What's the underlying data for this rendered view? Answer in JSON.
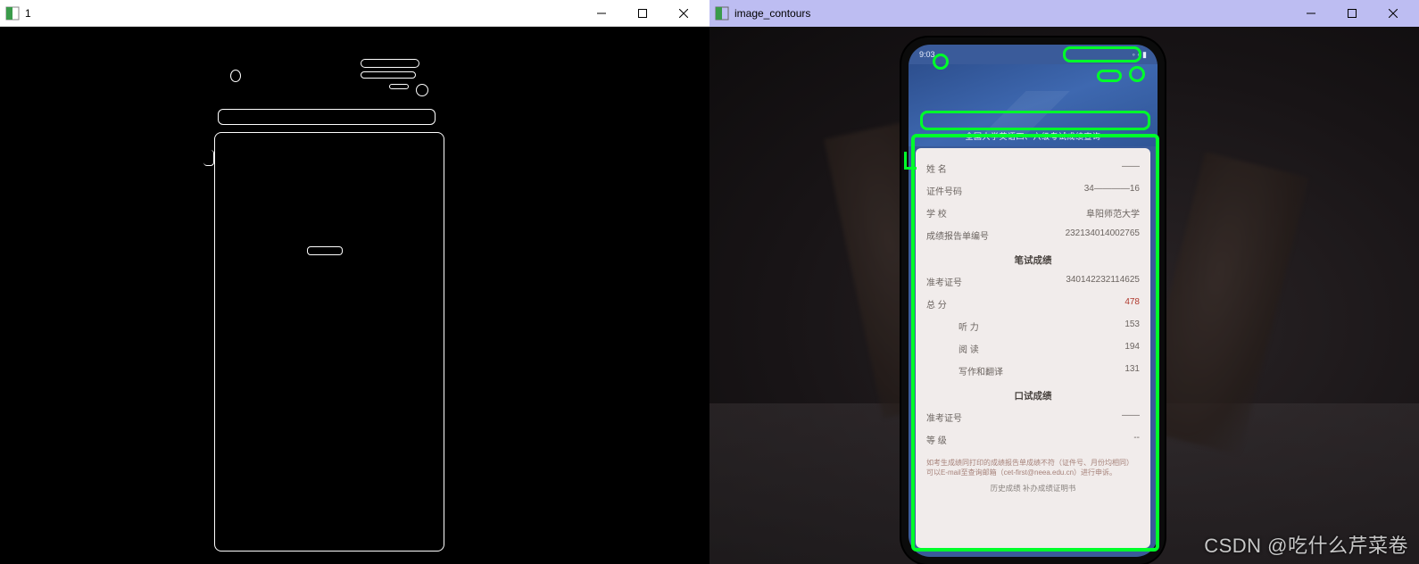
{
  "left_window": {
    "title": "1"
  },
  "right_window": {
    "title": "image_contours"
  },
  "phone": {
    "status_time": "9:03",
    "banner": "全国大学英语四、六级考试成绩查询",
    "fields": {
      "name_label": "姓 名",
      "name_value": "——",
      "id_label": "证件号码",
      "id_value": "34————16",
      "school_label": "学 校",
      "school_value": "阜阳师范大学",
      "report_label": "成绩报告单编号",
      "report_value": "232134014002765"
    },
    "written_header": "笔试成绩",
    "written": {
      "exam_no_label": "准考证号",
      "exam_no_value": "340142232114625",
      "total_label": "总 分",
      "total_value": "478",
      "listening_label": "听 力",
      "listening_value": "153",
      "reading_label": "阅 读",
      "reading_value": "194",
      "writing_label": "写作和翻译",
      "writing_value": "131"
    },
    "oral_header": "口试成绩",
    "oral": {
      "exam_no_label": "准考证号",
      "exam_no_value": "——",
      "grade_label": "等 级",
      "grade_value": "--"
    },
    "footnote": "如考生成绩同打印的成绩报告单成绩不符（证件号、月份均相同）可以E-mail至查询邮箱（cet-first@neea.edu.cn）进行申诉。",
    "foot_links": "历史成绩   补办成绩证明书"
  },
  "watermark": "CSDN @吃什么芹菜卷"
}
